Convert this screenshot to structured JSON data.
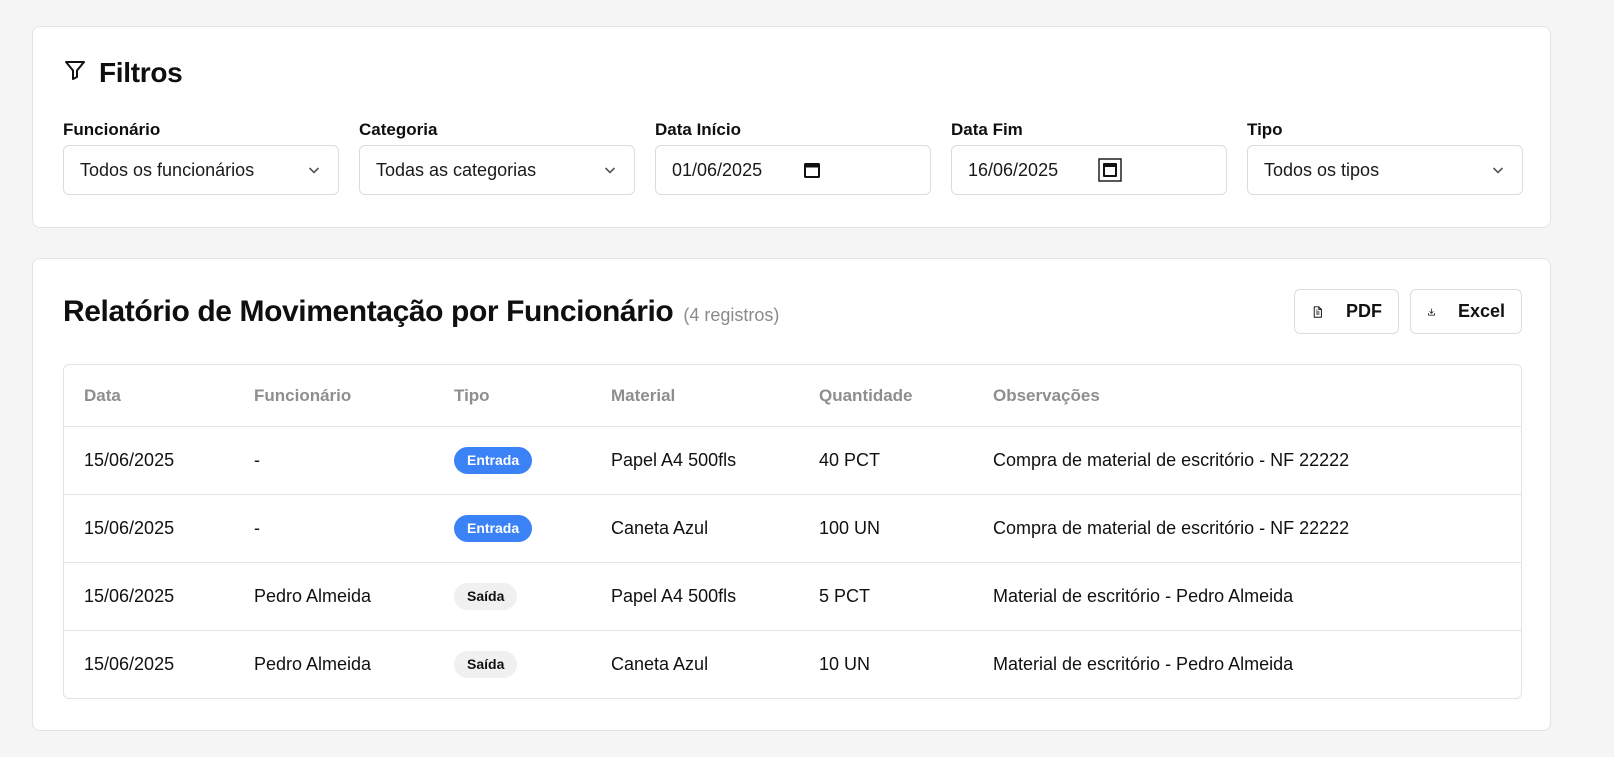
{
  "filters": {
    "title": "Filtros",
    "funcionario": {
      "label": "Funcionário",
      "value": "Todos os funcionários"
    },
    "categoria": {
      "label": "Categoria",
      "value": "Todas as categorias"
    },
    "data_inicio": {
      "label": "Data Início",
      "value": "01/06/2025"
    },
    "data_fim": {
      "label": "Data Fim",
      "value": "16/06/2025"
    },
    "tipo": {
      "label": "Tipo",
      "value": "Todos os tipos"
    }
  },
  "report": {
    "title": "Relatório de Movimentação por Funcionário",
    "count": "(4 registros)",
    "pdf_label": "PDF",
    "excel_label": "Excel",
    "columns": [
      "Data",
      "Funcionário",
      "Tipo",
      "Material",
      "Quantidade",
      "Observações"
    ],
    "rows": [
      {
        "data": "15/06/2025",
        "funcionario": "-",
        "tipo": "Entrada",
        "material": "Papel A4 500fls",
        "quantidade": "40 PCT",
        "observacoes": "Compra de material de escritório - NF 22222"
      },
      {
        "data": "15/06/2025",
        "funcionario": "-",
        "tipo": "Entrada",
        "material": "Caneta Azul",
        "quantidade": "100 UN",
        "observacoes": "Compra de material de escritório - NF 22222"
      },
      {
        "data": "15/06/2025",
        "funcionario": "Pedro Almeida",
        "tipo": "Saída",
        "material": "Papel A4 500fls",
        "quantidade": "5 PCT",
        "observacoes": "Material de escritório - Pedro Almeida"
      },
      {
        "data": "15/06/2025",
        "funcionario": "Pedro Almeida",
        "tipo": "Saída",
        "material": "Caneta Azul",
        "quantidade": "10 UN",
        "observacoes": "Material de escritório - Pedro Almeida"
      }
    ]
  },
  "colors": {
    "entrada_badge": "#3b82f6",
    "saida_badge": "#f0f0f0",
    "page_bg": "#f5f5f5"
  },
  "icons": [
    "filter-icon",
    "chevron-down-icon",
    "calendar-icon",
    "file-text-icon",
    "download-icon"
  ]
}
